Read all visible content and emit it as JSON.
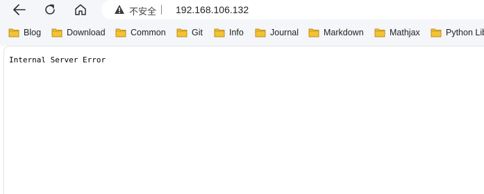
{
  "browser": {
    "security_label": "不安全",
    "url": "192.168.106.132",
    "bookmarks": [
      {
        "label": "Blog"
      },
      {
        "label": "Download"
      },
      {
        "label": "Common"
      },
      {
        "label": "Git"
      },
      {
        "label": "Info"
      },
      {
        "label": "Journal"
      },
      {
        "label": "Markdown"
      },
      {
        "label": "Mathjax"
      },
      {
        "label": "Python Lib"
      }
    ],
    "folder_color": "#f4c430"
  },
  "page": {
    "message": "Internal Server Error"
  }
}
